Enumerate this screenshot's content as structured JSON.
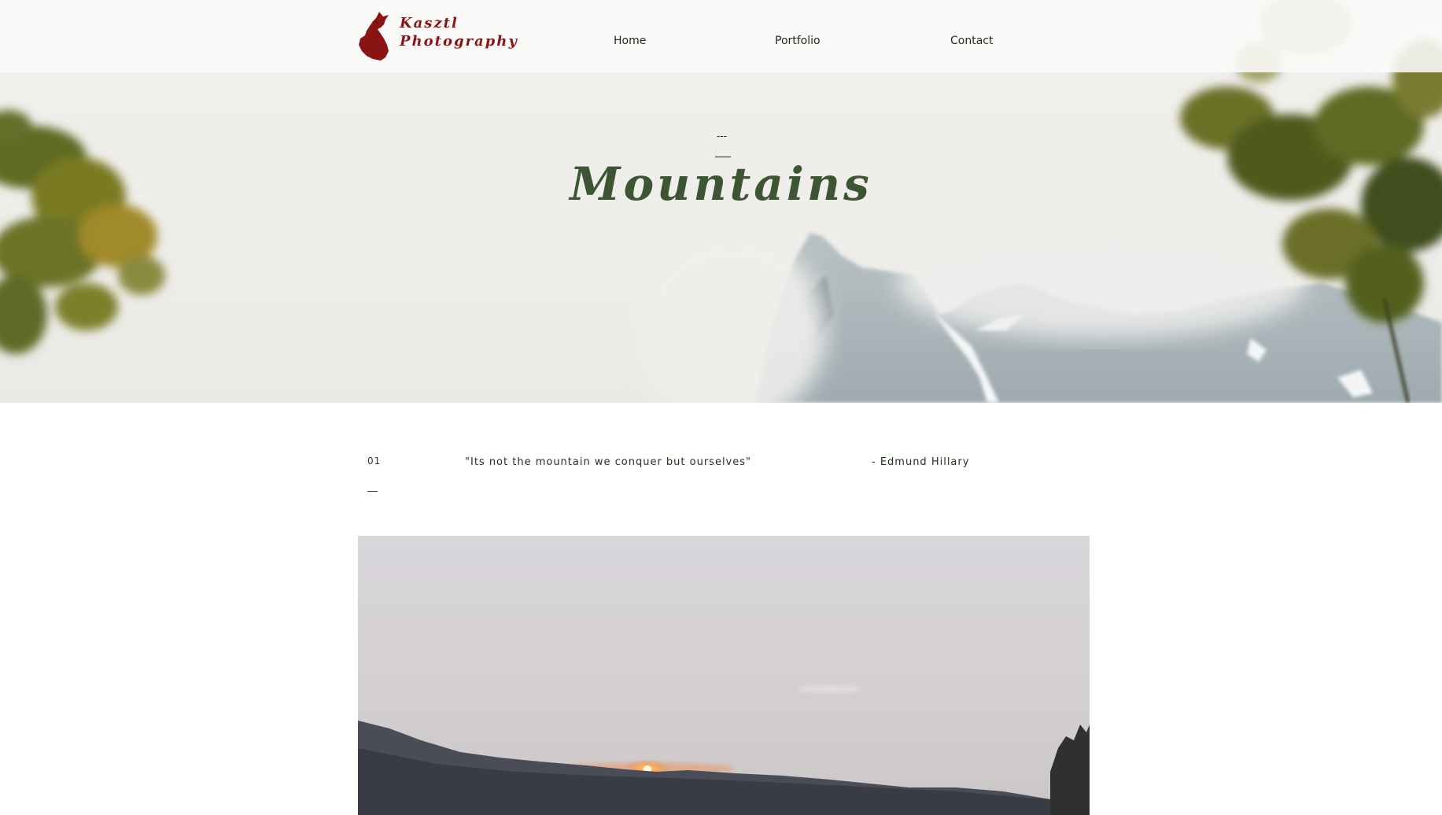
{
  "header": {
    "brand_line1": "Kasztl",
    "brand_line2": "Photography",
    "logo_icon": "howling-wolf-icon",
    "nav": [
      {
        "label": "Home"
      },
      {
        "label": "Portfolio"
      },
      {
        "label": "Contact"
      }
    ]
  },
  "hero": {
    "dash": "---",
    "title": "Mountains"
  },
  "quote": {
    "number": "01",
    "text": "\"Its not the mountain we conquer but ourselves\"",
    "author": "- Edmund Hillary"
  },
  "colors": {
    "brand_red": "#8a1414",
    "title_green": "#3d5533",
    "text_dark_green": "#23331f"
  }
}
